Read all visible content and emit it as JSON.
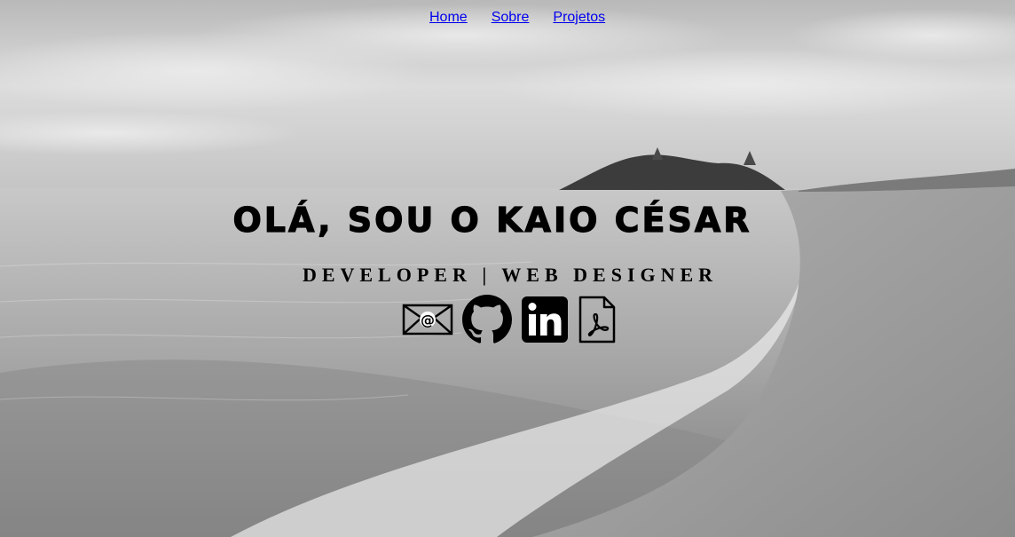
{
  "nav": {
    "items": [
      {
        "label": "Home"
      },
      {
        "label": "Sobre"
      },
      {
        "label": "Projetos"
      }
    ]
  },
  "hero": {
    "title": "OLÁ, SOU O KAIO CÉSAR",
    "subtitle": "DEVELOPER | WEB DESIGNER"
  },
  "icons": [
    "email-icon",
    "github-icon",
    "linkedin-icon",
    "pdf-icon"
  ],
  "colors": {
    "text": "#000000",
    "sky": "#cfcfcf",
    "sea": "#9c9c9c",
    "sand": "#8a8a8a"
  }
}
